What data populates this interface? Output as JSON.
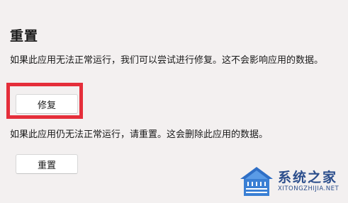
{
  "section": {
    "title": "重置",
    "repair_description": "如果此应用无法正常运行，我们可以尝试进行修复。这不会影响应用的数据。",
    "repair_button": "修复",
    "reset_description": "如果此应用仍无法正常运行，请重置。这会删除此应用的数据。",
    "reset_button": "重置"
  },
  "highlight": {
    "color": "#e52e3a",
    "target": "repair-button"
  },
  "watermark": {
    "name_cn": "系统之家",
    "name_en": "XITONGZHIJIA.NET",
    "icon": "house-logo-icon",
    "color": "#2c4e8c"
  }
}
